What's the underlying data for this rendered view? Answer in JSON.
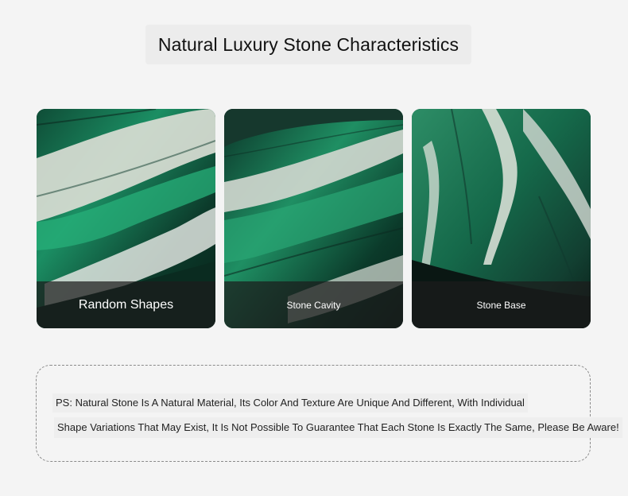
{
  "header": {
    "title": "Natural Luxury Stone Characteristics"
  },
  "cards": [
    {
      "caption": "Random Shapes",
      "image": "green-white-marble-texture-image"
    },
    {
      "caption": "Stone Cavity",
      "image": "green-marble-cavity-image"
    },
    {
      "caption": "Stone Base",
      "image": "green-marble-base-image"
    }
  ],
  "note": {
    "line1": "PS: Natural Stone Is A Natural Material, Its Color And Texture Are Unique And Different, With Individual",
    "line2": "Shape Variations That May Exist, It Is Not Possible To Guarantee That Each Stone Is Exactly The Same, Please Be Aware!"
  },
  "colors": {
    "background": "#f4f4f4",
    "title_panel": "#ececec",
    "stone_green": "#1f8a5a",
    "stone_dark": "#0f2f24",
    "caption_overlay": "#1c1c1c"
  }
}
